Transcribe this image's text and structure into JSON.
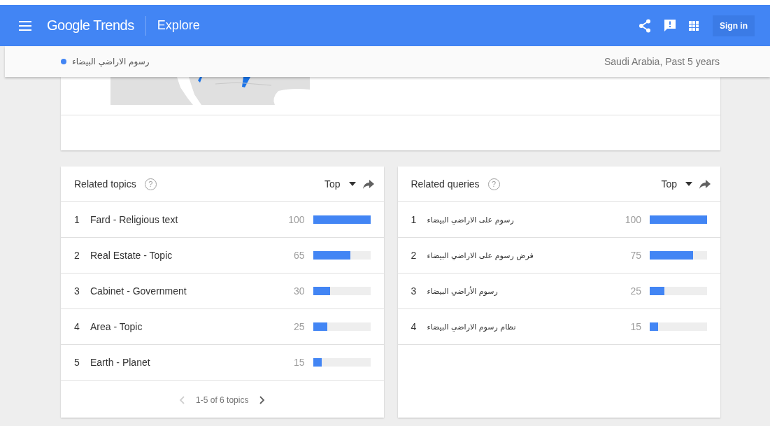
{
  "header": {
    "logo": "Google Trends",
    "section": "Explore",
    "sign_in": "Sign in"
  },
  "subheader": {
    "term": "رسوم الاراضي البيضاء",
    "scope": "Saudi Arabia, Past 5 years"
  },
  "panels": [
    {
      "title": "Related topics",
      "help": "?",
      "sort": "Top",
      "rows": [
        {
          "rank": "1",
          "label": "Fard - Religious text",
          "value": "100",
          "level": 1.0
        },
        {
          "rank": "2",
          "label": "Real Estate - Topic",
          "value": "65",
          "level": 0.65
        },
        {
          "rank": "3",
          "label": "Cabinet - Government",
          "value": "30",
          "level": 0.3
        },
        {
          "rank": "4",
          "label": "Area - Topic",
          "value": "25",
          "level": 0.25
        },
        {
          "rank": "5",
          "label": "Earth - Planet",
          "value": "15",
          "level": 0.15
        }
      ],
      "pager": {
        "text": "1-5 of 6 topics",
        "prev_disabled": true,
        "next_disabled": false
      }
    },
    {
      "title": "Related queries",
      "help": "?",
      "sort": "Top",
      "rows": [
        {
          "rank": "1",
          "label": "رسوم على الاراضي البيضاء",
          "value": "100",
          "level": 1.0
        },
        {
          "rank": "2",
          "label": "فرض رسوم على الاراضي البيضاء",
          "value": "75",
          "level": 0.75
        },
        {
          "rank": "3",
          "label": "رسوم الأراضي البيضاء",
          "value": "25",
          "level": 0.25
        },
        {
          "rank": "4",
          "label": "نظام رسوم الاراضي البيضاء",
          "value": "15",
          "level": 0.15
        }
      ]
    }
  ]
}
